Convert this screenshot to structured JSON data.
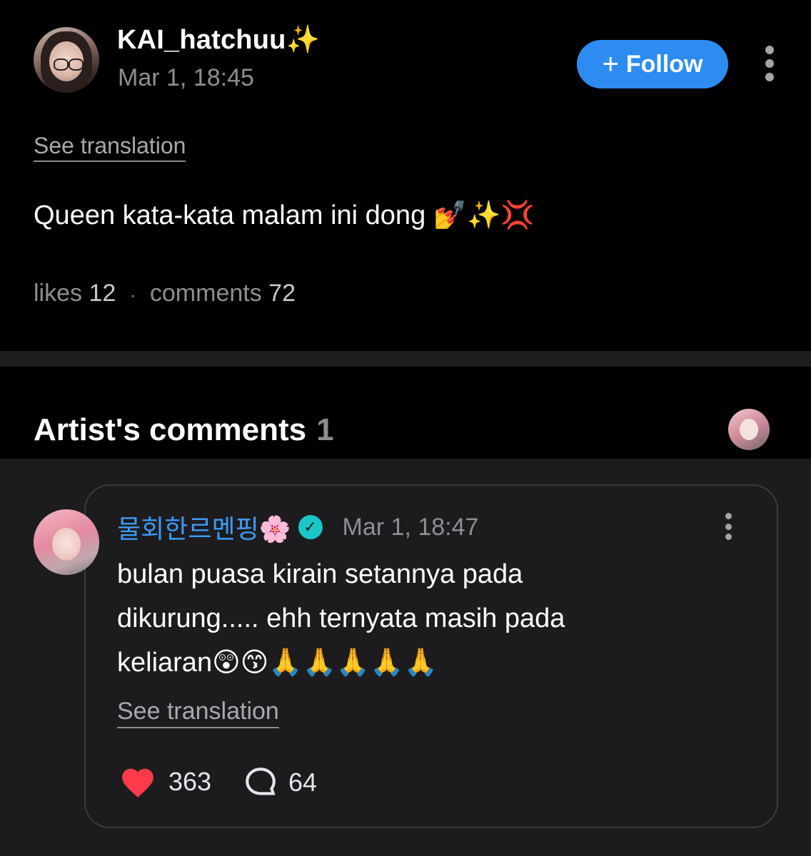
{
  "post": {
    "username": "KAI_hatchuu✨",
    "timestamp": "Mar 1, 18:45",
    "follow_label": "Follow",
    "see_translation": "See translation",
    "body": "Queen kata-kata malam ini dong 💅✨💢",
    "likes_label": "likes",
    "likes_count": "12",
    "separator": "·",
    "comments_label": "comments",
    "comments_count": "72"
  },
  "artist_comments": {
    "title": "Artist's comments",
    "count": "1"
  },
  "comment": {
    "username": "물회한르멘핑🌸",
    "timestamp": "Mar 1, 18:47",
    "line1": "bulan puasa kirain setannya pada",
    "line2": "dikurung..... ehh ternyata masih pada",
    "line3": "keliaran😲😙🙏🙏🙏🙏🙏",
    "see_translation": "See translation",
    "likes": "363",
    "replies": "64"
  },
  "colors": {
    "accent": "#2e8cf0",
    "commenter_name": "#3d9bf5",
    "verified_badge": "#19c7c7",
    "heart": "#ff3b4b"
  },
  "icons": [
    "plus-icon",
    "kebab-icon",
    "verified-icon",
    "heart-icon",
    "reply-bubble-icon"
  ]
}
